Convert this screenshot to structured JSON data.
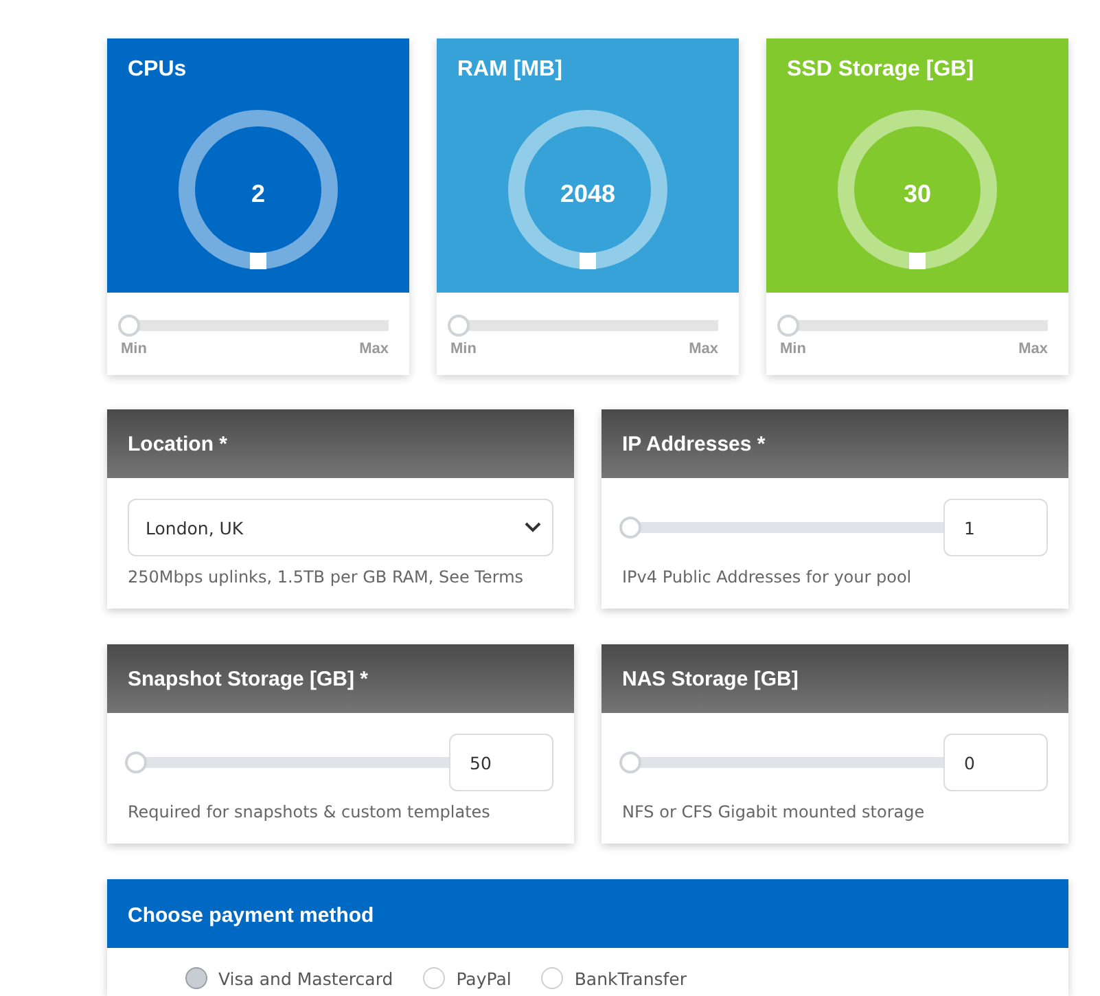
{
  "gauges": [
    {
      "title": "CPUs",
      "value": "2",
      "color": "#0069c4",
      "min_label": "Min",
      "max_label": "Max",
      "level": 0
    },
    {
      "title": "RAM [MB]",
      "value": "2048",
      "color": "#37a2d8",
      "min_label": "Min",
      "max_label": "Max",
      "level": 0
    },
    {
      "title": "SSD Storage [GB]",
      "value": "30",
      "color": "#82c92e",
      "min_label": "Min",
      "max_label": "Max",
      "level": 0
    }
  ],
  "sections": [
    {
      "title": "Location *",
      "kind": "select",
      "value": "London, UK",
      "note": "250Mbps uplinks, 1.5TB per GB RAM, See Terms"
    },
    {
      "title": "IP Addresses *",
      "kind": "range",
      "level": 0,
      "value": "1",
      "note": "IPv4 Public Addresses for your pool"
    },
    {
      "title": "Snapshot Storage [GB] *",
      "kind": "range",
      "level": 0,
      "value": "50",
      "note": "Required for snapshots & custom templates"
    },
    {
      "title": "NAS Storage [GB]",
      "kind": "range",
      "level": 0,
      "value": "0",
      "note": "NFS or CFS Gigabit mounted storage"
    }
  ],
  "payment": {
    "title": "Choose payment method",
    "options": [
      {
        "label": "Visa and Mastercard",
        "selected": true
      },
      {
        "label": "PayPal",
        "selected": false
      },
      {
        "label": "BankTransfer",
        "selected": false
      }
    ]
  }
}
